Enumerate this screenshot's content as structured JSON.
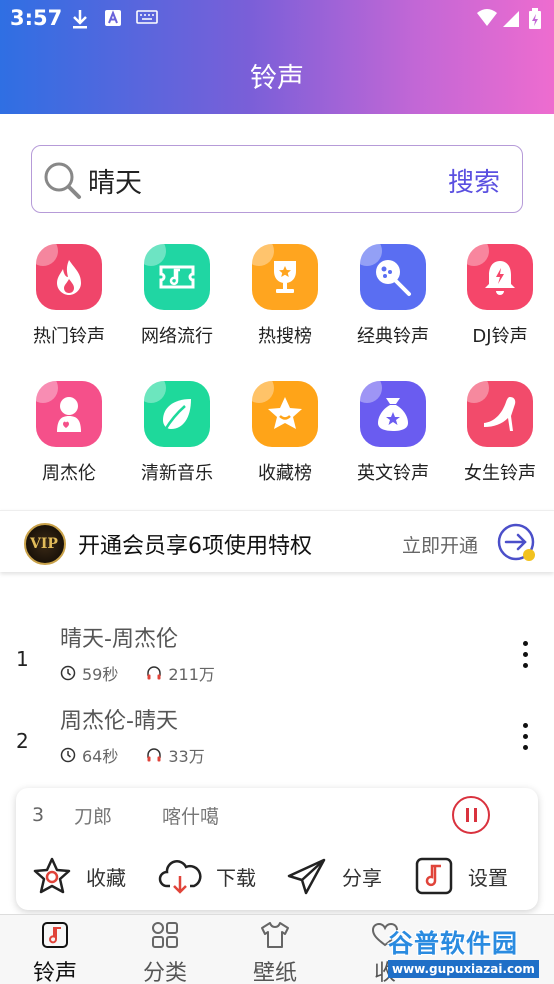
{
  "status_bar": {
    "time": "3:57",
    "icons": [
      "download-icon",
      "font-icon",
      "keyboard-icon",
      "wifi-icon",
      "signal-icon",
      "battery-icon"
    ]
  },
  "header": {
    "title": "铃声"
  },
  "search": {
    "value": "晴天",
    "button_label": "搜索"
  },
  "categories": [
    {
      "label": "热门铃声",
      "icon": "flame-icon",
      "color": "#f0456a"
    },
    {
      "label": "网络流行",
      "icon": "ticket-icon",
      "color": "#20d6a3"
    },
    {
      "label": "热搜榜",
      "icon": "trophy-icon",
      "color": "#ffa51f"
    },
    {
      "label": "经典铃声",
      "icon": "guitar-icon",
      "color": "#5a6ef2"
    },
    {
      "label": "DJ铃声",
      "icon": "bell-icon",
      "color": "#f5466a"
    },
    {
      "label": "周杰伦",
      "icon": "person-icon",
      "color": "#f5508a"
    },
    {
      "label": "清新音乐",
      "icon": "leaf-icon",
      "color": "#1ed99b"
    },
    {
      "label": "收藏榜",
      "icon": "star-icon",
      "color": "#ffa418"
    },
    {
      "label": "英文铃声",
      "icon": "moneybag-icon",
      "color": "#6a5cf0"
    },
    {
      "label": "女生铃声",
      "icon": "heel-icon",
      "color": "#f24b6b"
    }
  ],
  "vip": {
    "badge": "VIP",
    "text": "开通会员享6项使用特权",
    "link": "立即开通"
  },
  "songs": [
    {
      "index": "1",
      "title": "晴天-周杰伦",
      "duration": "59秒",
      "plays": "211万"
    },
    {
      "index": "2",
      "title": "周杰伦-晴天",
      "duration": "64秒",
      "plays": "33万"
    }
  ],
  "player": {
    "index": "3",
    "marquee": [
      "刀郎",
      "喀什噶"
    ],
    "actions": [
      {
        "label": "收藏",
        "icon": "star-outline-icon"
      },
      {
        "label": "下载",
        "icon": "cloud-download-icon"
      },
      {
        "label": "分享",
        "icon": "send-icon"
      },
      {
        "label": "设置",
        "icon": "music-note-icon"
      }
    ]
  },
  "bottom_nav": [
    {
      "label": "铃声",
      "icon": "music-note-icon",
      "active": true
    },
    {
      "label": "分类",
      "icon": "grid-icon",
      "active": false
    },
    {
      "label": "壁纸",
      "icon": "shirt-icon",
      "active": false
    },
    {
      "label": "收",
      "icon": "heart-icon",
      "active": false
    }
  ],
  "watermark": {
    "text": "谷普软件园",
    "url": "www.gupuxiazai.com"
  },
  "colors": {
    "accent": "#5a4fe0",
    "pause_red": "#d9323e",
    "header_start": "#2f6fe3",
    "header_end": "#ee6ccf"
  }
}
